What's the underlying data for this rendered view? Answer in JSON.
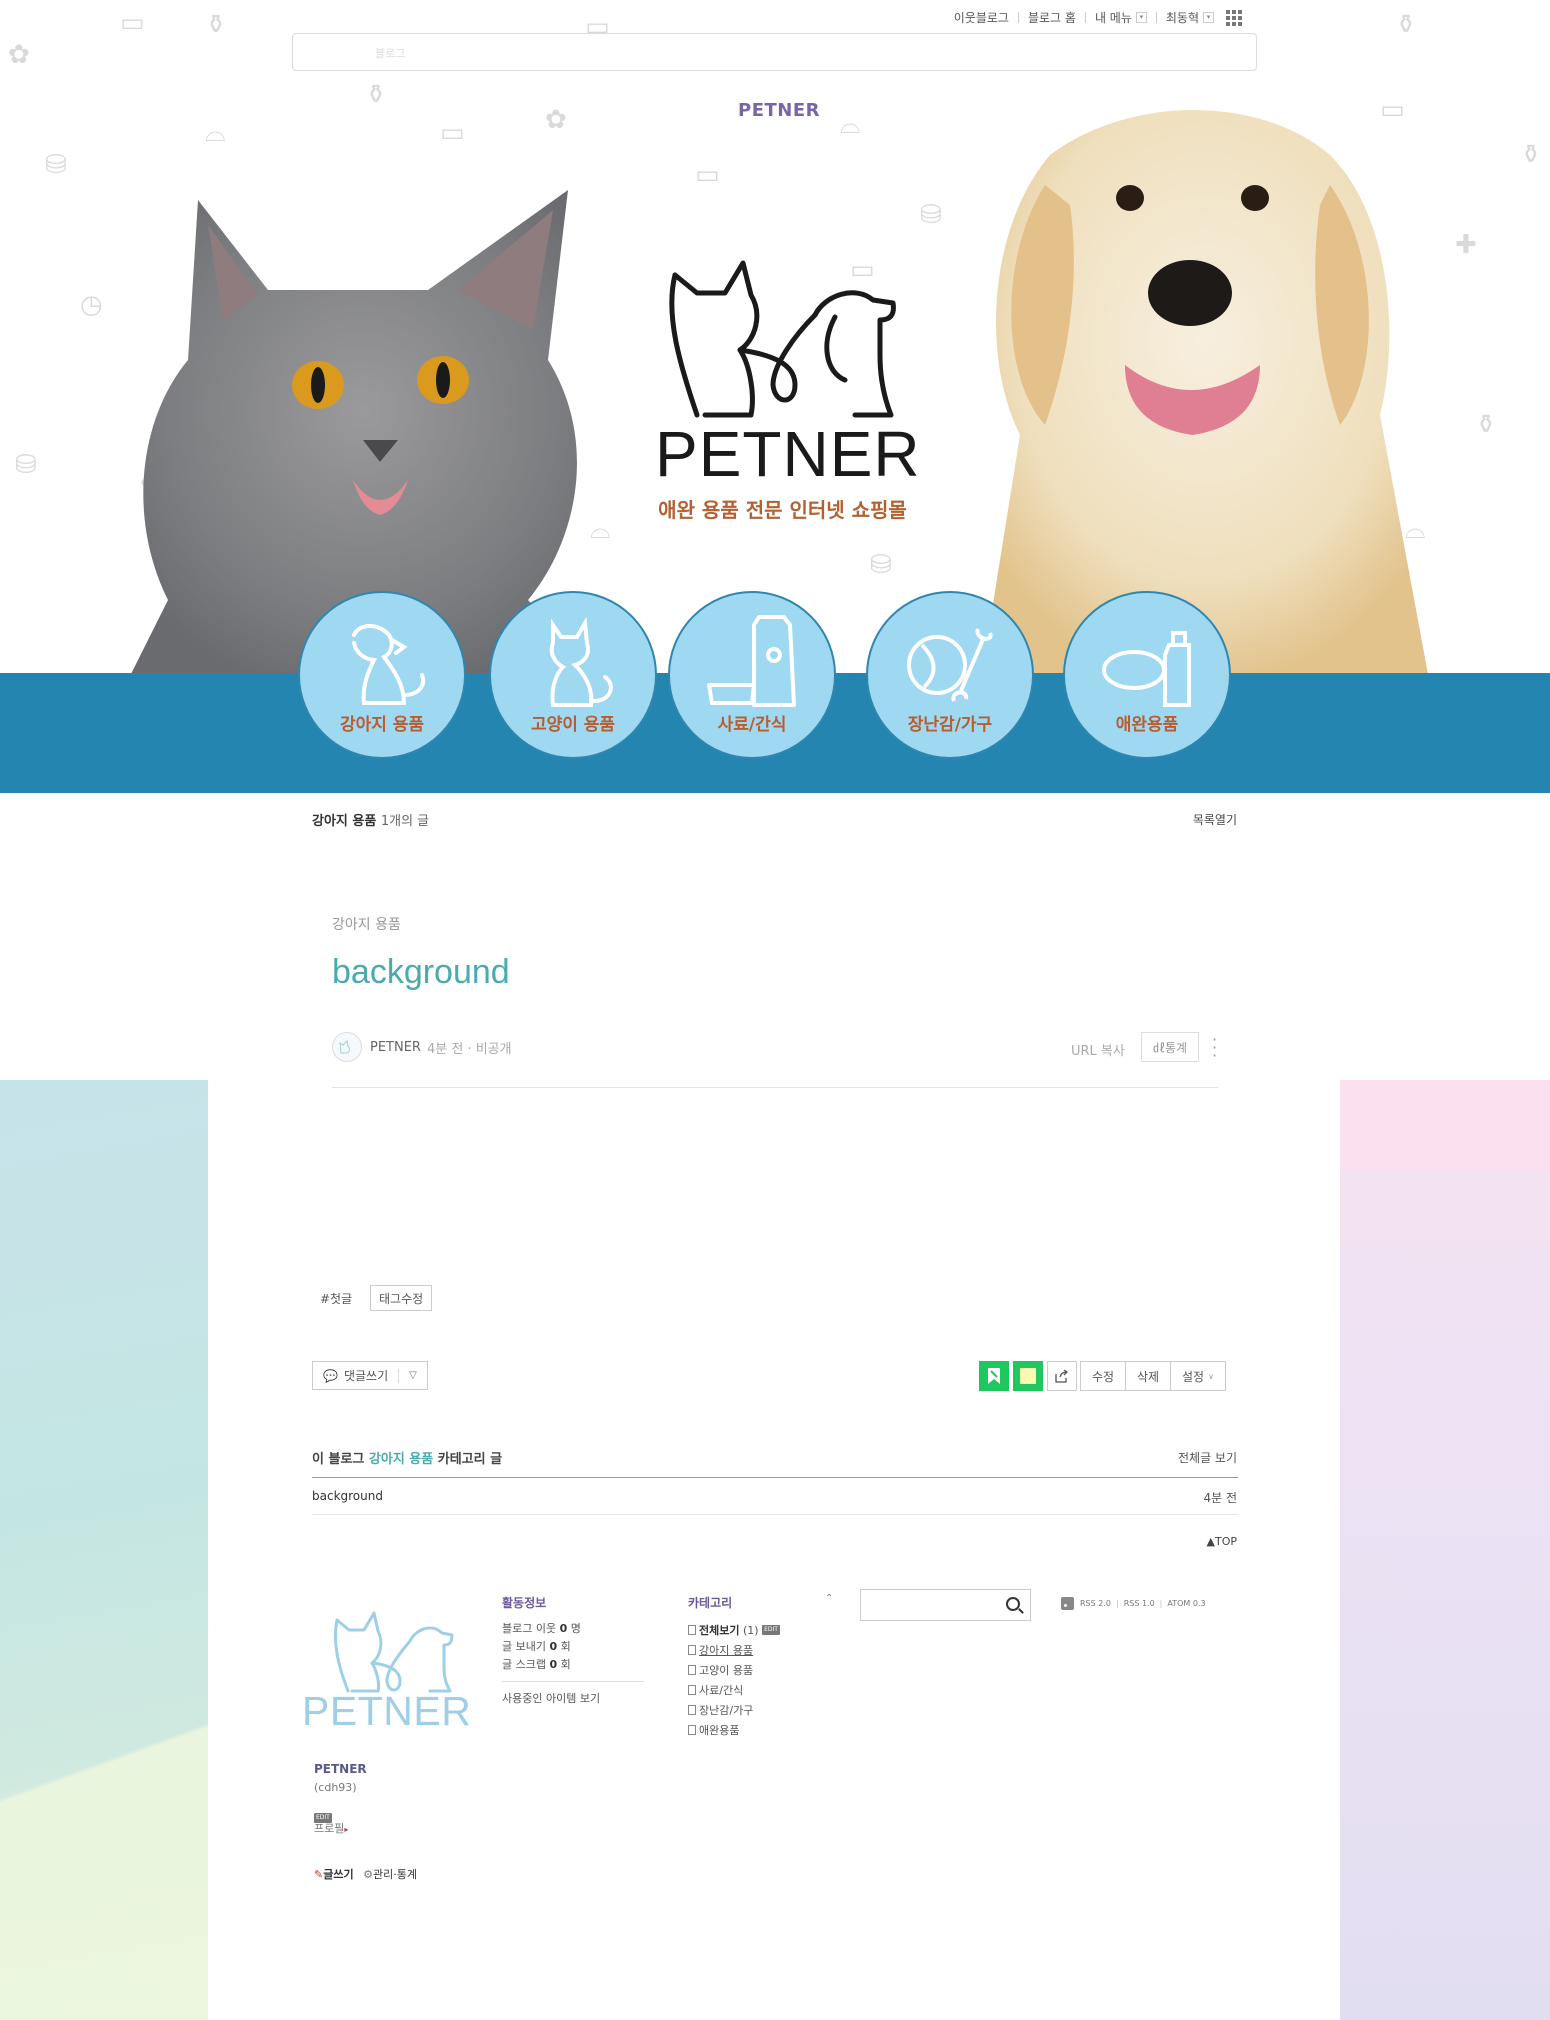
{
  "topnav": {
    "neighbor_blog": "이웃블로그",
    "blog_home": "블로그 홈",
    "my_menu": "내 메뉴",
    "my_menu_caret": "▾",
    "user_menu": "최동혁",
    "user_caret": "▾"
  },
  "search": {
    "placeholder": "블로그"
  },
  "header": {
    "brand_small": "PETNER",
    "logo_word": "PETNER",
    "slogan": "애완 용품 전문 인터넷 쇼핑몰"
  },
  "categories_nav": [
    {
      "label": "강아지 용품",
      "icon": "dog-icon"
    },
    {
      "label": "고양이 용품",
      "icon": "cat-icon"
    },
    {
      "label": "사료/간식",
      "icon": "pet-food-icon"
    },
    {
      "label": "장난감/가구",
      "icon": "ball-bone-icon"
    },
    {
      "label": "애완용품",
      "icon": "collar-bottle-icon"
    }
  ],
  "list_header": {
    "category": "강아지 용품",
    "count": "1개의 글",
    "open_list": "목록열기"
  },
  "post": {
    "category": "강아지 용품",
    "title": "background",
    "author": "PETNER",
    "time": "4분 전",
    "visibility": "비공개",
    "time_visibility": "4분 전 · 비공개",
    "url_copy": "URL 복사",
    "stats": "통계",
    "stats_full": "㎗통계",
    "tag": "#첫글",
    "tag_edit": "태그수정"
  },
  "post_actions": {
    "reply": "댓글쓰기",
    "edit": "수정",
    "delete": "삭제",
    "settings": "설정"
  },
  "related": {
    "prefix": "이 블로그",
    "category": "강아지 용품",
    "suffix": "카테고리 글",
    "view_all": "전체글 보기",
    "rows": [
      {
        "title": "background",
        "time": "4분 전"
      }
    ],
    "top": "▲TOP"
  },
  "profile": {
    "logo_word": "PETNER",
    "name": "PETNER",
    "id": "(cdh93)",
    "edit": "EDIT",
    "profile_link": "프로필",
    "write": "글쓰기",
    "manage": "관리·통계"
  },
  "activity": {
    "title": "활동정보",
    "neighbors_label": "블로그 이웃",
    "neighbors_value": "0",
    "neighbors_unit": "명",
    "sends_label": "글 보내기",
    "sends_value": "0",
    "sends_unit": "회",
    "scraps_label": "글 스크랩",
    "scraps_value": "0",
    "scraps_unit": "회",
    "items": "사용중인 아이템 보기"
  },
  "category_widget": {
    "title": "카테고리",
    "caret": "⌃",
    "all": "전체보기",
    "all_count": "(1)",
    "edit": "EDIT",
    "items": [
      "강아지 용품",
      "고양이 용품",
      "사료/간식",
      "장난감/가구",
      "애완용품"
    ]
  },
  "feeds": {
    "rss2": "RSS 2.0",
    "rss1": "RSS 1.0",
    "atom": "ATOM 0.3"
  },
  "colors": {
    "banner_blue": "#2585b1",
    "circle_fill": "#9ed8f1",
    "title_teal": "#4aabad",
    "label_orange": "#b95c2f",
    "accent_green": "#1ec85e"
  }
}
